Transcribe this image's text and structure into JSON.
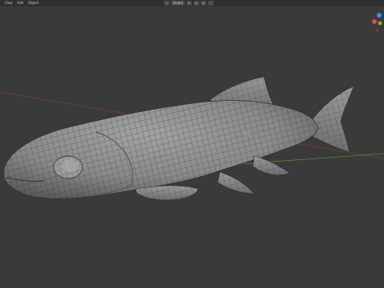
{
  "menu": {
    "items": [
      "View",
      "Add",
      "Object"
    ]
  },
  "toolbar": {
    "transform_orientation": "Global"
  },
  "icons": {
    "pivot": "pivot-point-icon",
    "snap": "snap-icon",
    "proportional": "proportional-edit-icon",
    "overlay": "overlay-icon"
  },
  "colors": {
    "background": "#3a3a3a",
    "header": "#303030",
    "mesh": "#8a8a8a",
    "wire": "#2f2f2f",
    "axis_x": "#7a3f3f",
    "axis_y": "#6b7f3a",
    "gizmo_x": "#e0464e",
    "gizmo_y": "#6fbd2c",
    "gizmo_z": "#3d8ef0"
  }
}
